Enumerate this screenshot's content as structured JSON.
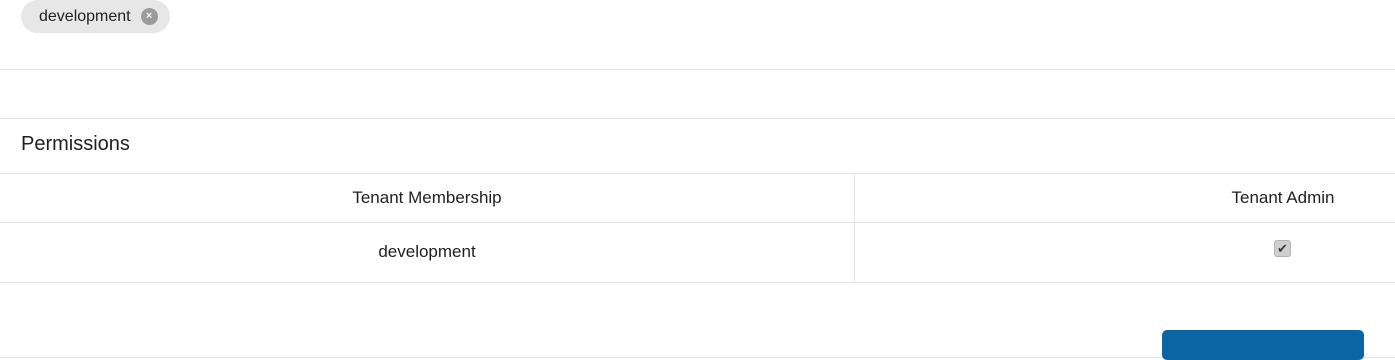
{
  "chip": {
    "label": "development",
    "remove_icon": "×"
  },
  "permissions": {
    "title": "Permissions",
    "columns": [
      "Tenant Membership",
      "Tenant Admin"
    ],
    "rows": [
      {
        "tenant": "development",
        "admin_checked": true,
        "check_glyph": "✔"
      }
    ]
  },
  "colors": {
    "accent": "#0b64a4",
    "chip_bg": "#e7e7e7",
    "border": "#e3e3e3"
  }
}
